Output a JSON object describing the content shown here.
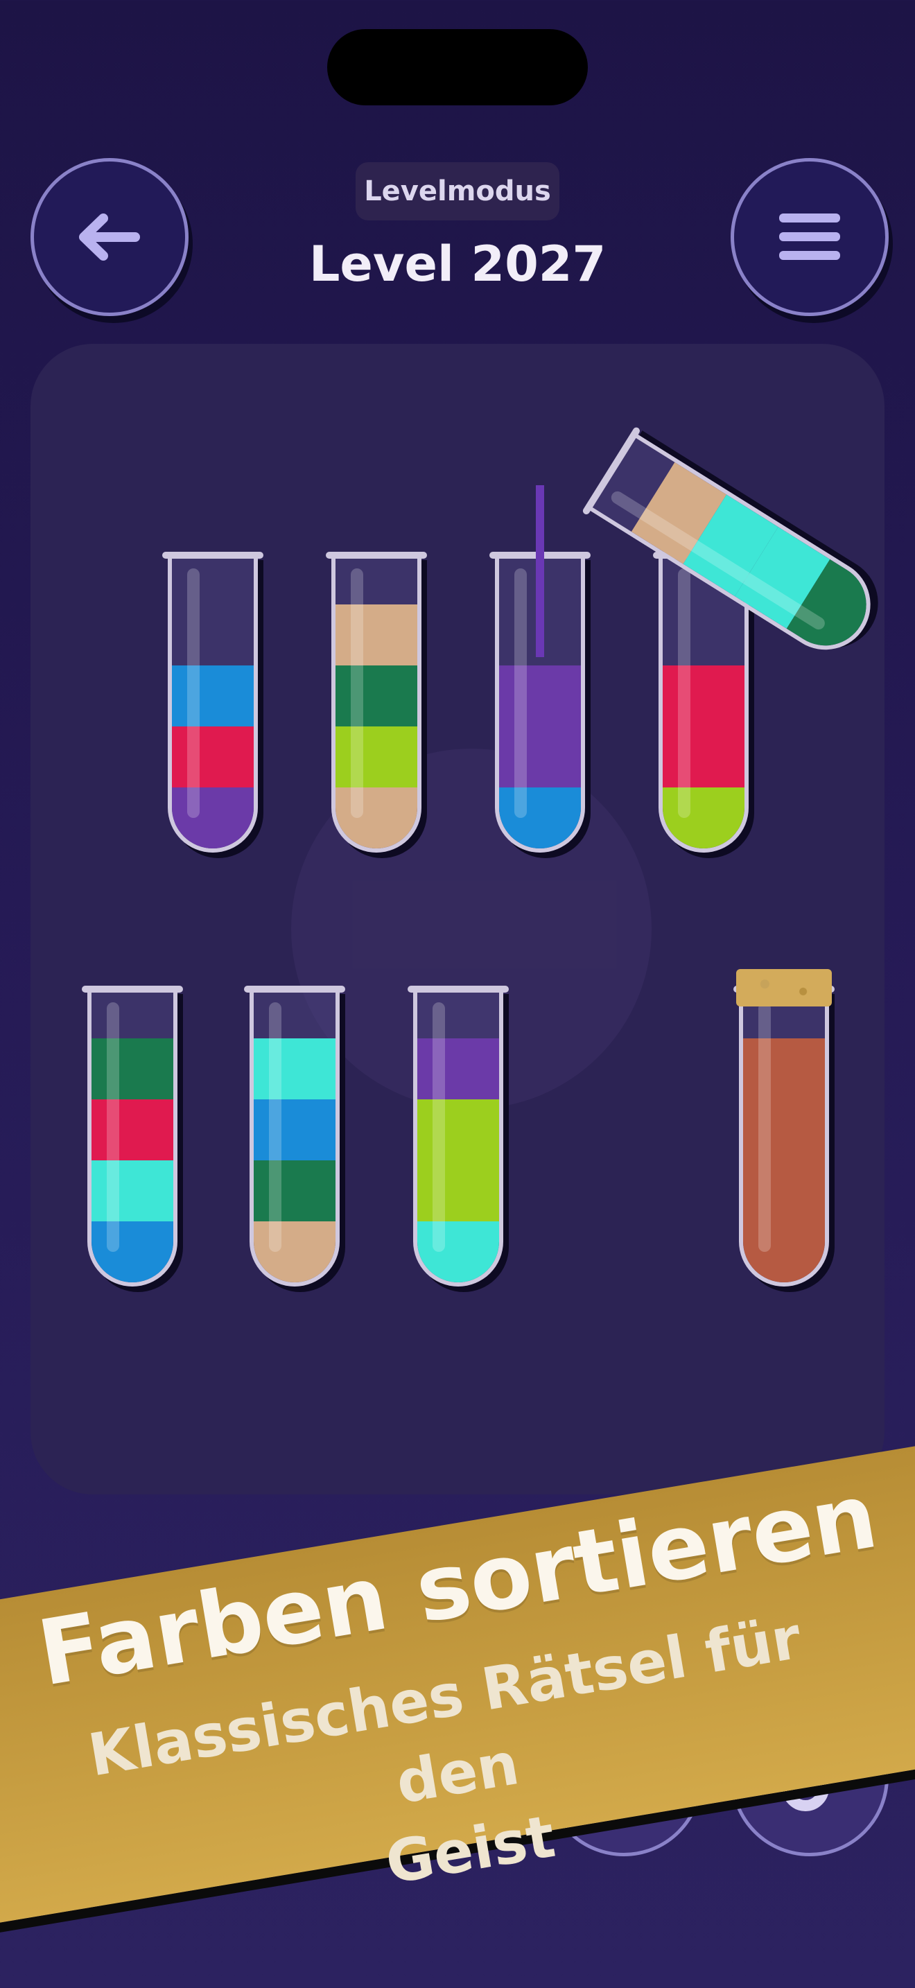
{
  "header": {
    "back_icon": "arrow-left-icon",
    "menu_icon": "hamburger-menu-icon",
    "mode_label": "Levelmodus",
    "level_title": "Level 2027"
  },
  "colors": {
    "purple": "#6b3aa8",
    "blue": "#1a8cd8",
    "red": "#e01a4f",
    "green": "#1a7a4e",
    "lime": "#9ccf1e",
    "tan": "#d4ac88",
    "cyan": "#3ee6d6",
    "brown": "#b65a42",
    "accent_gold": "#c89e40"
  },
  "tubes": [
    {
      "id": "tube-1",
      "layers": [
        "purple",
        "red",
        "blue"
      ]
    },
    {
      "id": "tube-2",
      "layers": [
        "tan",
        "lime",
        "green",
        "tan"
      ]
    },
    {
      "id": "tube-3",
      "layers": [
        "blue",
        "purple",
        "purple"
      ]
    },
    {
      "id": "tube-4",
      "layers": [
        "lime",
        "red",
        "red"
      ]
    },
    {
      "id": "tube-5",
      "layers": [
        "blue",
        "cyan",
        "red",
        "green"
      ]
    },
    {
      "id": "tube-6",
      "layers": [
        "tan",
        "green",
        "blue",
        "cyan"
      ]
    },
    {
      "id": "tube-7",
      "layers": [
        "cyan",
        "lime",
        "lime",
        "purple"
      ]
    },
    {
      "id": "tube-8",
      "layers": [
        "brown",
        "brown",
        "brown",
        "brown"
      ],
      "corked": true
    },
    {
      "id": "tube-pouring",
      "layers": [
        "green",
        "cyan",
        "cyan",
        "tan"
      ]
    }
  ],
  "banner": {
    "title": "Farben sortieren",
    "subtitle_line1": "Klassisches Rätsel für den",
    "subtitle_line2": "Geist"
  },
  "boosters": [
    {
      "name": "hint-lightbulb-icon",
      "count": ""
    },
    {
      "name": "add-tube-icon",
      "count": "5"
    }
  ]
}
